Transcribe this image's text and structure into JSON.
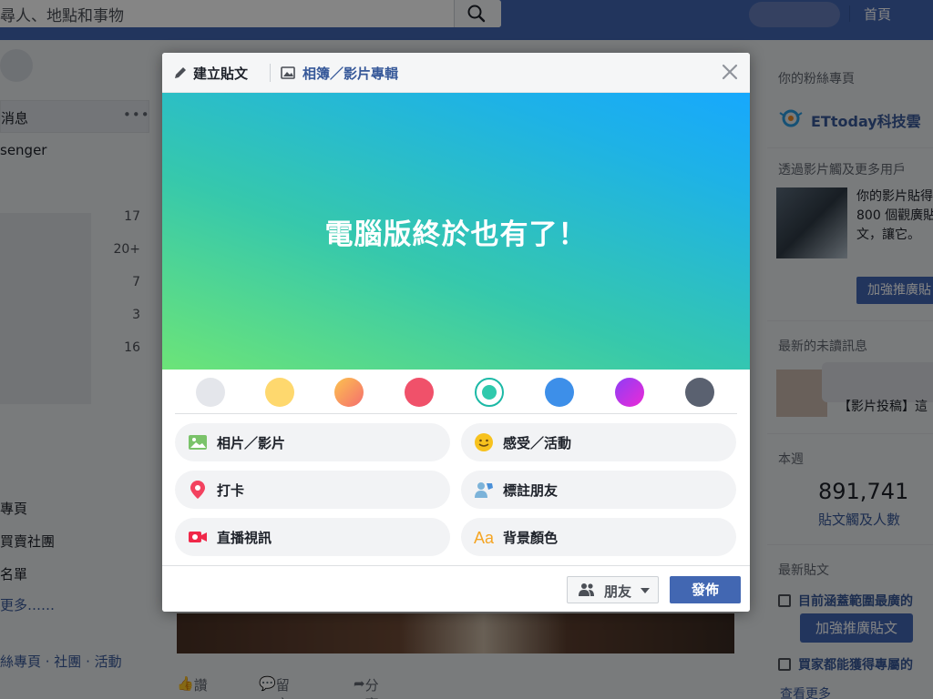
{
  "topbar": {
    "search_text": "尋人、地點和事物",
    "home_label": "首頁"
  },
  "left": {
    "messages_label": "消息",
    "messages_more": "•••",
    "messenger_label": "senger",
    "counts": [
      "17",
      "20+",
      "7",
      "3",
      "16"
    ],
    "links": [
      "專頁",
      "買賣社團",
      "名單"
    ],
    "more_label": "更多……",
    "footer": "絲專頁 · 社團 · 活動"
  },
  "right": {
    "fan_pages_heading": "你的粉絲專頁",
    "brand_name": "ETtoday科技雲",
    "video_heading": "透過影片觸及更多用戶",
    "video_text": "你的影片貼得 800 個觀廣貼文，讓它。",
    "boost_label": "加強推廣貼",
    "unread_heading": "最新的未讀訊息",
    "unread_text": "【影片投稿】這",
    "week_heading": "本週",
    "reach_value": "891,741",
    "reach_label": "貼文觸及人數",
    "latest_heading": "最新貼文",
    "post1": "目前涵蓋範圍最廣的",
    "boost_post_label": "加強推廣貼文",
    "post2": "買家都能獲得專屬的",
    "see_more": "查看更多"
  },
  "feed": {
    "like": "讚",
    "comment": "留言",
    "share": "分享"
  },
  "modal": {
    "tab_create": "建立貼文",
    "tab_album": "相簿／影片專輯",
    "canvas_text": "電腦版終於也有了！",
    "swatch_colors": [
      "#e4e6eb",
      "#fed86e",
      "#f8a05a",
      "#f0516a",
      "#2fc9ac",
      "#3d8fe9",
      "#b93bec",
      "#5a6170"
    ],
    "selected_swatch": 4,
    "options": [
      {
        "label": "相片／影片",
        "icon": "photo-icon"
      },
      {
        "label": "感受／活動",
        "icon": "smiley-icon"
      },
      {
        "label": "打卡",
        "icon": "location-pin-icon"
      },
      {
        "label": "標註朋友",
        "icon": "tag-friends-icon"
      },
      {
        "label": "直播視訊",
        "icon": "live-video-icon"
      },
      {
        "label": "背景顏色",
        "icon": "text-aa-icon"
      }
    ],
    "audience_label": "朋友",
    "publish_label": "發佈"
  }
}
